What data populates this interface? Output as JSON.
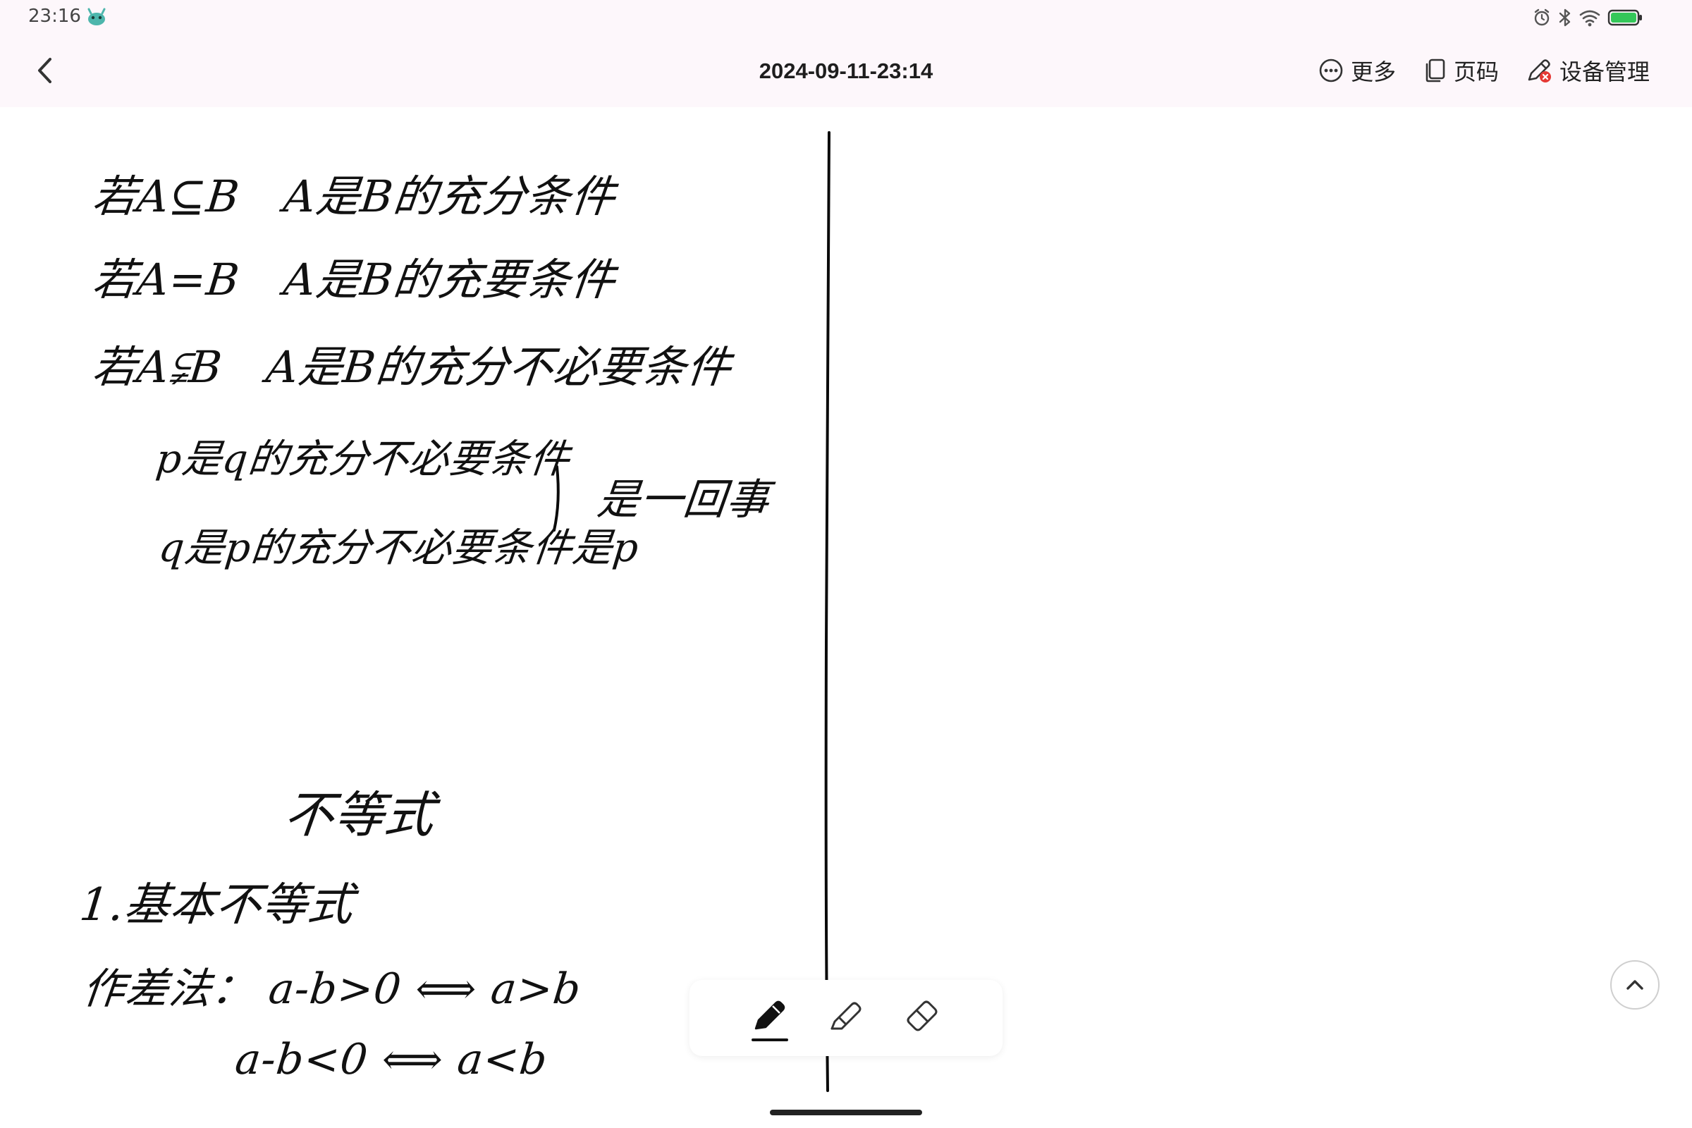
{
  "status_bar": {
    "time": "23:16",
    "app_icon": "android-mascot-icon",
    "icons": [
      "alarm-icon",
      "bluetooth-icon",
      "wifi-icon",
      "battery-icon"
    ],
    "battery_level": 1.0,
    "battery_color": "#34c759"
  },
  "header": {
    "back_icon": "chevron-left-icon",
    "title": "2024-09-11-23:14",
    "actions": [
      {
        "icon": "more-dots-icon",
        "label": "更多"
      },
      {
        "icon": "page-copy-icon",
        "label": "页码"
      },
      {
        "icon": "pen-device-icon",
        "label": "设备管理",
        "badge_color": "#e53935"
      }
    ]
  },
  "note": {
    "lines": [
      "若A⊆B　A是B的充分条件",
      "若A=B　A是B的充要条件",
      "若A⫋B　A是B的充分不必要条件",
      "p是q的充分不必要条件",
      "q是p的充分不必要条件是p",
      "是一回事",
      "不等式",
      "1.基本不等式",
      "作差法：  a-b>0 ⟺ a>b",
      "a-b<0 ⟺ a<b"
    ]
  },
  "toolbar": {
    "tools": [
      {
        "icon": "pen-icon",
        "active": true
      },
      {
        "icon": "highlighter-icon",
        "active": false
      },
      {
        "icon": "eraser-icon",
        "active": false
      }
    ]
  },
  "scroll_top_icon": "chevron-up-icon",
  "colors": {
    "header_bg": "#fdf7fb",
    "ink": "#0a0a0a",
    "page_bg": "#ffffff"
  }
}
